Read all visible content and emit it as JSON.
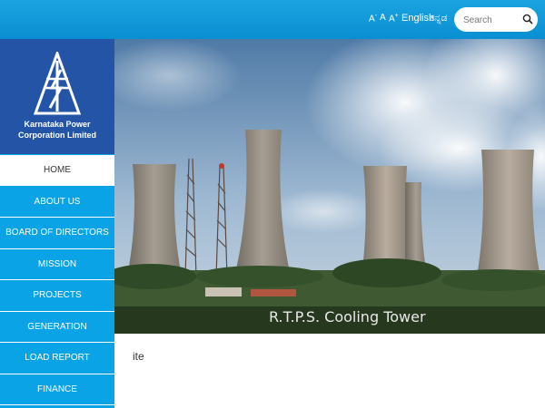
{
  "header": {
    "font_controls": {
      "decrease": "A",
      "normal": "A",
      "increase": "A"
    },
    "languages": {
      "english": "English",
      "kannada": "ಕನ್ನಡ"
    },
    "search": {
      "placeholder": "Search",
      "icon": "search-icon"
    },
    "colors": {
      "bar": "#0a8fd2"
    }
  },
  "logo": {
    "line1": "Karnataka Power",
    "line2": "Corporation Limited",
    "colors": {
      "background": "#2354a6"
    }
  },
  "sidebar": {
    "items": [
      {
        "label": "HOME",
        "active": true
      },
      {
        "label": "ABOUT US"
      },
      {
        "label": "BOARD OF DIRECTORS"
      },
      {
        "label": "MISSION"
      },
      {
        "label": "PROJECTS"
      },
      {
        "label": "GENERATION"
      },
      {
        "label": "LOAD REPORT"
      },
      {
        "label": "FINANCE"
      }
    ],
    "colors": {
      "background": "#0aa3e6",
      "active": "#ffffff"
    }
  },
  "hero": {
    "caption": "R.T.P.S. Cooling Tower"
  },
  "main": {
    "text": "ite"
  }
}
